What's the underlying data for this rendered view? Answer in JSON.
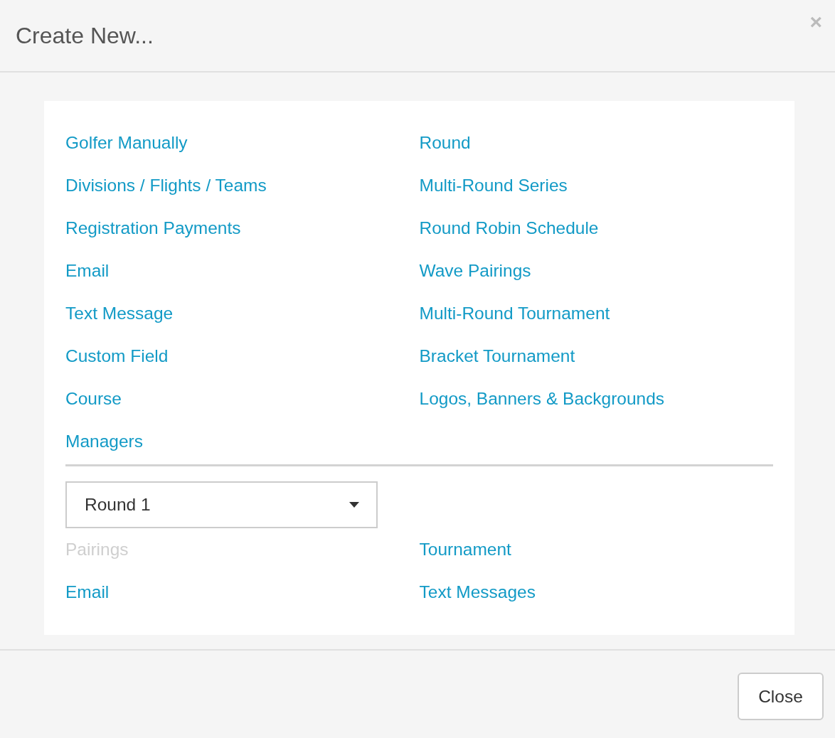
{
  "dialog": {
    "title": "Create New...",
    "close_icon": "×"
  },
  "links": [
    {
      "label": "Golfer Manually",
      "disabled": false
    },
    {
      "label": "Round",
      "disabled": false
    },
    {
      "label": "Divisions / Flights / Teams",
      "disabled": false
    },
    {
      "label": "Multi-Round Series",
      "disabled": false
    },
    {
      "label": "Registration Payments",
      "disabled": false
    },
    {
      "label": "Round Robin Schedule",
      "disabled": false
    },
    {
      "label": "Email",
      "disabled": false
    },
    {
      "label": "Wave Pairings",
      "disabled": false
    },
    {
      "label": "Text Message",
      "disabled": false
    },
    {
      "label": "Multi-Round Tournament",
      "disabled": false
    },
    {
      "label": "Custom Field",
      "disabled": false
    },
    {
      "label": "Bracket Tournament",
      "disabled": false
    },
    {
      "label": "Course",
      "disabled": false
    },
    {
      "label": "Logos, Banners & Backgrounds",
      "disabled": false
    },
    {
      "label": "Managers",
      "disabled": false
    }
  ],
  "round_select": {
    "value": "Round 1"
  },
  "round_links": [
    {
      "label": "Pairings",
      "disabled": true
    },
    {
      "label": "Tournament",
      "disabled": false
    },
    {
      "label": "Email",
      "disabled": false
    },
    {
      "label": "Text Messages",
      "disabled": false
    }
  ],
  "footer": {
    "buttons": [
      "Close"
    ]
  }
}
